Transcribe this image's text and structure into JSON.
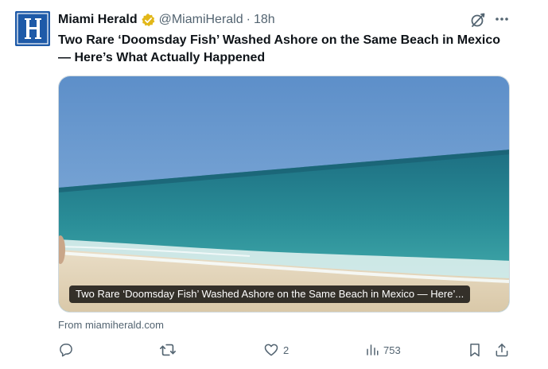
{
  "post": {
    "author_name": "Miami Herald",
    "handle": "@MiamiHerald",
    "separator": "·",
    "time": "18h",
    "headline": "Two Rare ‘Doomsday Fish’ Washed Ashore on the Same Beach in Mexico — Here’s What Actually Happened",
    "card_caption": "Two Rare ‘Doomsday Fish’ Washed Ashore on the Same Beach in Mexico — Here’...",
    "source": "From miamiherald.com",
    "likes": "2",
    "views": "753"
  },
  "icons": {
    "avatar": "miami-herald-logo",
    "verified": "verified-badge-icon",
    "grok": "grok-icon",
    "more": "more-icon",
    "reply": "reply-icon",
    "repost": "repost-icon",
    "like": "heart-icon",
    "views": "views-icon",
    "bookmark": "bookmark-icon",
    "share": "share-icon"
  },
  "colors": {
    "verified_gold": "#e2b719",
    "text_primary": "#0f1419",
    "text_secondary": "#536471",
    "avatar_blue": "#1e5aa8"
  }
}
